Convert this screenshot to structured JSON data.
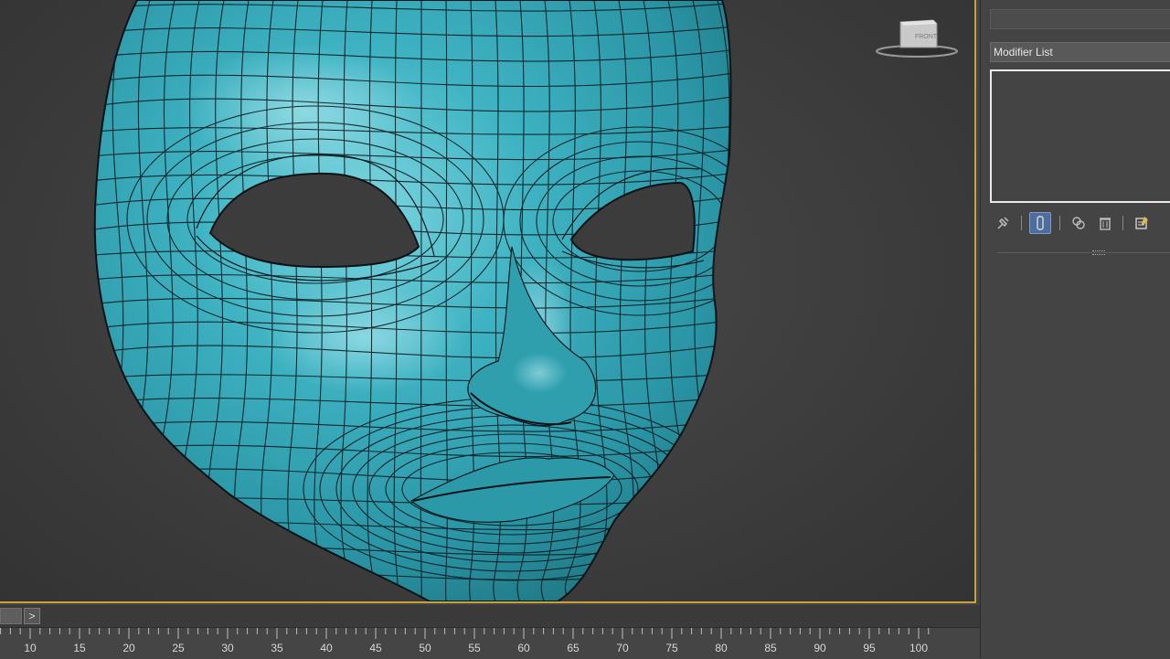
{
  "viewport": {
    "viewcube_face": "FRONT",
    "mesh_color": "#32a7b6",
    "wire_color": "#0c1a1e",
    "active_border_color": "#c8a33a"
  },
  "command_panel": {
    "name_value": "",
    "modifier_list_label": "Modifier List",
    "stack_tools": [
      {
        "name": "pin-stack-icon",
        "active": false
      },
      {
        "name": "show-end-result-icon",
        "active": true
      },
      {
        "name": "make-unique-icon",
        "active": false
      },
      {
        "name": "remove-modifier-icon",
        "active": false
      },
      {
        "name": "configure-modifier-sets-icon",
        "active": false
      }
    ]
  },
  "time_slider": {
    "next_label": ">"
  },
  "trackbar": {
    "ticks": [
      "10",
      "15",
      "20",
      "25",
      "30",
      "35",
      "40",
      "45",
      "50",
      "55",
      "60",
      "65",
      "70",
      "75",
      "80",
      "85",
      "90",
      "95",
      "100"
    ]
  }
}
